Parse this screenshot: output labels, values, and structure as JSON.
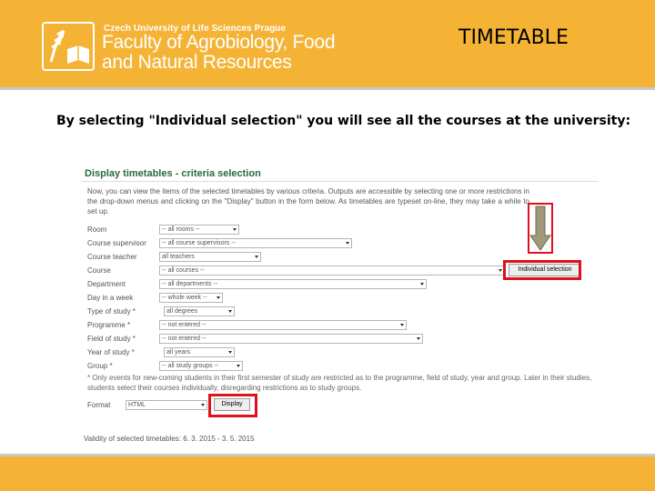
{
  "header": {
    "university": "Czech University of Life Sciences Prague",
    "faculty_line1": "Faculty of Agrobiology, Food",
    "faculty_line2": "and Natural Resources",
    "slide_title": "TIMETABLE"
  },
  "intro_text": "By selecting \"Individual selection\" you will see all the courses at the university:",
  "screenshot": {
    "title": "Display timetables - criteria selection",
    "description": "Now, you can view the items of the selected timetables by various criteria. Outputs are accessible by selecting one or more restrictions in the drop-down menus and clicking on the \"Display\" button in the form below. As timetables are typeset on-line, they may take a while to set up.",
    "fields": [
      {
        "label": "Room",
        "value": "-- all rooms --"
      },
      {
        "label": "Course supervisor",
        "value": "-- all course supervisors --"
      },
      {
        "label": "Course teacher",
        "value": "all teachers"
      },
      {
        "label": "Course",
        "value": "-- all courses --"
      },
      {
        "label": "Department",
        "value": "-- all departments --"
      },
      {
        "label": "Day in a week",
        "value": "-- whole week --"
      },
      {
        "label": "Type of study *",
        "value": "all degrees"
      },
      {
        "label": "Programme *",
        "value": "-- not entered --"
      },
      {
        "label": "Field of study *",
        "value": "-- not entered --"
      },
      {
        "label": "Year of study *",
        "value": "all years"
      },
      {
        "label": "Group *",
        "value": "-- all study groups --"
      }
    ],
    "note": "* Only events for new-coming students in their first semester of study are restricted as to the programme, field of study, year and group. Later in their studies, students select their courses individually, disregarding restrictions as to study groups.",
    "individual_button": "Individual selection",
    "format_label": "Format",
    "format_value": "HTML",
    "display_button": "Display",
    "validity": "Validity of selected timetables: 6. 3. 2015 - 3. 5. 2015"
  },
  "colors": {
    "banner": "#f5b335",
    "highlight": "#e0101c",
    "heading_green": "#2a6a3e"
  }
}
